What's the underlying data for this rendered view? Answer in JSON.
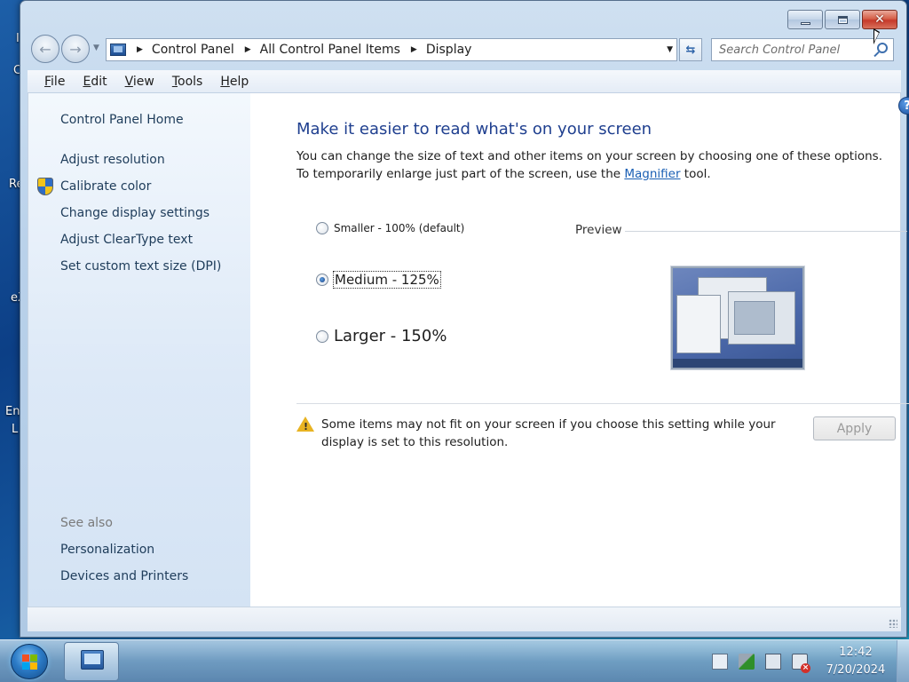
{
  "desktop": {
    "fragments": [
      "I",
      "C",
      "Re",
      "eX",
      "En",
      "L"
    ]
  },
  "window": {
    "caption_buttons": {
      "minimize": "minimize",
      "maximize": "maximize",
      "close": "close"
    }
  },
  "address": {
    "breadcrumbs": [
      "Control Panel",
      "All Control Panel Items",
      "Display"
    ]
  },
  "search": {
    "placeholder": "Search Control Panel"
  },
  "menu": {
    "items": [
      {
        "accel": "F",
        "rest": "ile"
      },
      {
        "accel": "E",
        "rest": "dit"
      },
      {
        "accel": "V",
        "rest": "iew"
      },
      {
        "accel": "T",
        "rest": "ools"
      },
      {
        "accel": "H",
        "rest": "elp"
      }
    ]
  },
  "sidebar": {
    "home": "Control Panel Home",
    "links": [
      "Adjust resolution",
      "Calibrate color",
      "Change display settings",
      "Adjust ClearType text",
      "Set custom text size (DPI)"
    ],
    "see_also": "See also",
    "see_also_links": [
      "Personalization",
      "Devices and Printers"
    ]
  },
  "main": {
    "title": "Make it easier to read what's on your screen",
    "description_pre": "You can change the size of text and other items on your screen by choosing one of these options. To temporarily enlarge just part of the screen, use the ",
    "magnifier_link": "Magnifier",
    "description_post": " tool.",
    "options": [
      {
        "label": "Smaller - 100% (default)",
        "checked": false
      },
      {
        "label": "Medium - 125%",
        "checked": true
      },
      {
        "label": "Larger - 150%",
        "checked": false
      }
    ],
    "preview_label": "Preview",
    "warning": "Some items may not fit on your screen if you choose this setting while your display is set to this resolution.",
    "apply": "Apply"
  },
  "taskbar": {
    "time": "12:42",
    "date": "7/20/2024"
  },
  "icons": [
    "back-icon",
    "forward-icon",
    "control-panel-icon",
    "refresh-icon",
    "search-icon",
    "help-icon",
    "uac-shield-icon",
    "warning-icon",
    "start-orb-icon",
    "control-panel-task-icon",
    "action-center-icon",
    "network-icon",
    "volume-muted-icon"
  ],
  "colors": {
    "title_blue": "#1f3f8f",
    "link_blue": "#1a5fb4",
    "close_red": "#c6392a",
    "warning_yellow": "#e8b322"
  }
}
